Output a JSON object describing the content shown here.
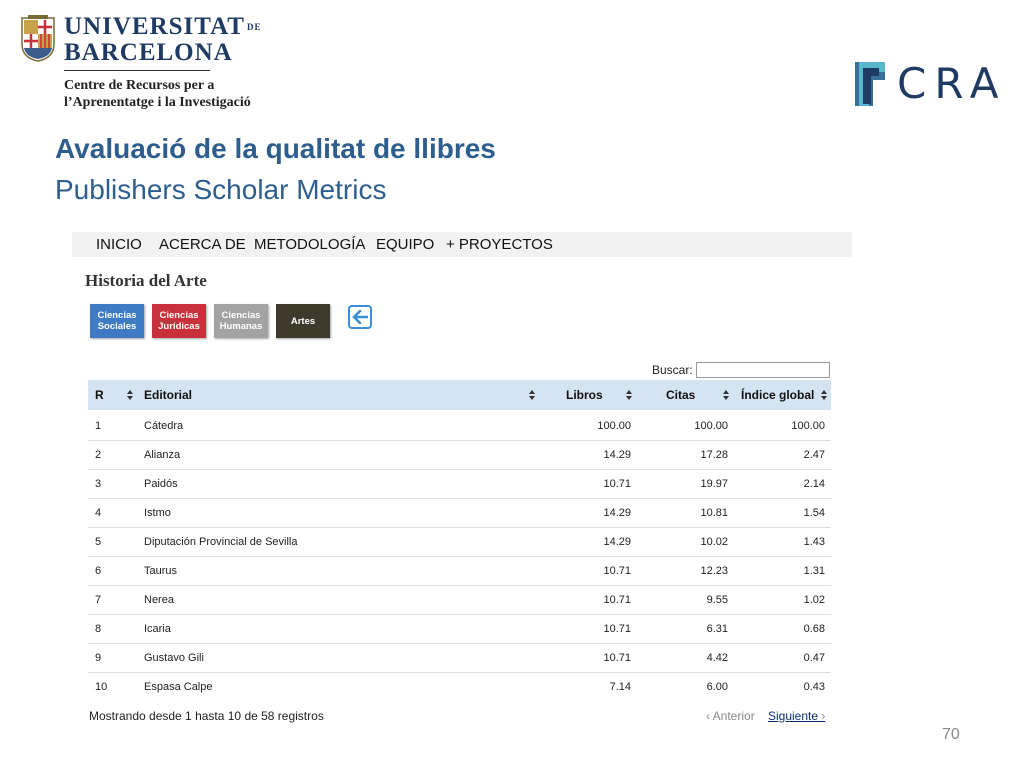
{
  "branding": {
    "university_line1": "UNIVERSITAT",
    "university_de": "DE",
    "university_line2": "BARCELONA",
    "crai_line1": "Centre de Recursos per a",
    "crai_line2": "l’Aprenentatge i la Investigació",
    "crai_logo_text": "CRAI"
  },
  "title": "Avaluació de la qualitat de llibres",
  "subtitle": "Publishers Scholar Metrics",
  "nav": [
    "INICIO",
    "ACERCA DE",
    "METODOLOGÍA",
    "EQUIPO",
    "+ PROYECTOS"
  ],
  "section_heading": "Historia del Arte",
  "categories": [
    {
      "line1": "Ciencias",
      "line2": "Sociales",
      "color": "#3e7bc4"
    },
    {
      "line1": "Ciencias",
      "line2": "Jurídicas",
      "color": "#c8313b"
    },
    {
      "line1": "Ciencias",
      "line2": "Humanas",
      "color": "#a3a3a3"
    },
    {
      "line1": "Artes",
      "line2": "",
      "color": "#3d3a2c"
    }
  ],
  "search": {
    "label": "Buscar:",
    "value": ""
  },
  "table": {
    "headers": {
      "rank": "R",
      "editorial": "Editorial",
      "libros": "Libros",
      "citas": "Citas",
      "indice": "Índice global"
    },
    "rows": [
      {
        "r": "1",
        "editorial": "Cátedra",
        "libros": "100.00",
        "citas": "100.00",
        "indice": "100.00"
      },
      {
        "r": "2",
        "editorial": "Alianza",
        "libros": "14.29",
        "citas": "17.28",
        "indice": "2.47"
      },
      {
        "r": "3",
        "editorial": "Paidós",
        "libros": "10.71",
        "citas": "19.97",
        "indice": "2.14"
      },
      {
        "r": "4",
        "editorial": "Istmo",
        "libros": "14.29",
        "citas": "10.81",
        "indice": "1.54"
      },
      {
        "r": "5",
        "editorial": "Diputación Provincial de Sevilla",
        "libros": "14.29",
        "citas": "10.02",
        "indice": "1.43"
      },
      {
        "r": "6",
        "editorial": "Taurus",
        "libros": "10.71",
        "citas": "12.23",
        "indice": "1.31"
      },
      {
        "r": "7",
        "editorial": "Nerea",
        "libros": "10.71",
        "citas": "9.55",
        "indice": "1.02"
      },
      {
        "r": "8",
        "editorial": "Icaria",
        "libros": "10.71",
        "citas": "6.31",
        "indice": "0.68"
      },
      {
        "r": "9",
        "editorial": "Gustavo Gili",
        "libros": "10.71",
        "citas": "4.42",
        "indice": "0.47"
      },
      {
        "r": "10",
        "editorial": "Espasa Calpe",
        "libros": "7.14",
        "citas": "6.00",
        "indice": "0.43"
      }
    ]
  },
  "footer": {
    "info": "Mostrando desde 1 hasta 10 de 58 registros",
    "prev": "Anterior",
    "next": "Siguiente"
  },
  "slide_number": "70",
  "colors": {
    "title": "#2d5e8e",
    "table_header": "#d4e4f2",
    "ub_blue": "#1f3a63"
  }
}
